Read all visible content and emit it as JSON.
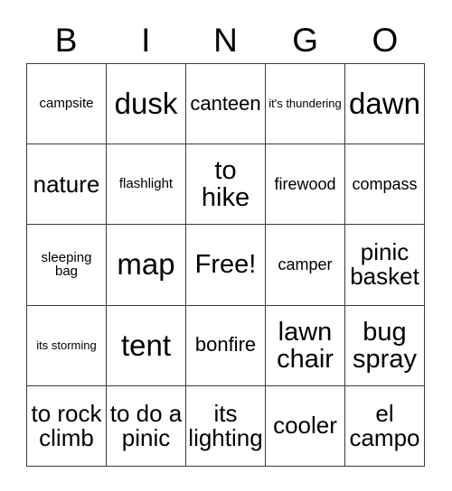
{
  "card": {
    "title": "BINGO",
    "header_letters": [
      "B",
      "I",
      "N",
      "G",
      "O"
    ],
    "columns": 5,
    "rows": 5,
    "free_space_label": "Free!",
    "free_space_position": {
      "row": 3,
      "column": 3
    },
    "border_color": "#3a3a3a",
    "background_color": "#ffffff",
    "text_color": "#000000",
    "cells": [
      [
        {
          "text": "campsite",
          "size": "xs"
        },
        {
          "text": "dusk",
          "size": "xxl"
        },
        {
          "text": "canteen",
          "size": "md"
        },
        {
          "text": "it's thundering",
          "size": "xxs"
        },
        {
          "text": "dawn",
          "size": "xxl"
        }
      ],
      [
        {
          "text": "nature",
          "size": "lg"
        },
        {
          "text": "flashlight",
          "size": "xs"
        },
        {
          "text": "to hike",
          "size": "xl"
        },
        {
          "text": "firewood",
          "size": "sm"
        },
        {
          "text": "compass",
          "size": "sm"
        }
      ],
      [
        {
          "text": "sleeping bag",
          "size": "xs"
        },
        {
          "text": "map",
          "size": "xxl"
        },
        {
          "text": "Free!",
          "size": "xl"
        },
        {
          "text": "camper",
          "size": "sm"
        },
        {
          "text": "pinic basket",
          "size": "lg"
        }
      ],
      [
        {
          "text": "its storming",
          "size": "xxs"
        },
        {
          "text": "tent",
          "size": "xxl"
        },
        {
          "text": "bonfire",
          "size": "md"
        },
        {
          "text": "lawn chair",
          "size": "xl"
        },
        {
          "text": "bug spray",
          "size": "xl"
        }
      ],
      [
        {
          "text": "to rock climb",
          "size": "lg"
        },
        {
          "text": "to do a pinic",
          "size": "lg"
        },
        {
          "text": "its lighting",
          "size": "lg"
        },
        {
          "text": "cooler",
          "size": "lg"
        },
        {
          "text": "el campo",
          "size": "lg"
        }
      ]
    ]
  }
}
